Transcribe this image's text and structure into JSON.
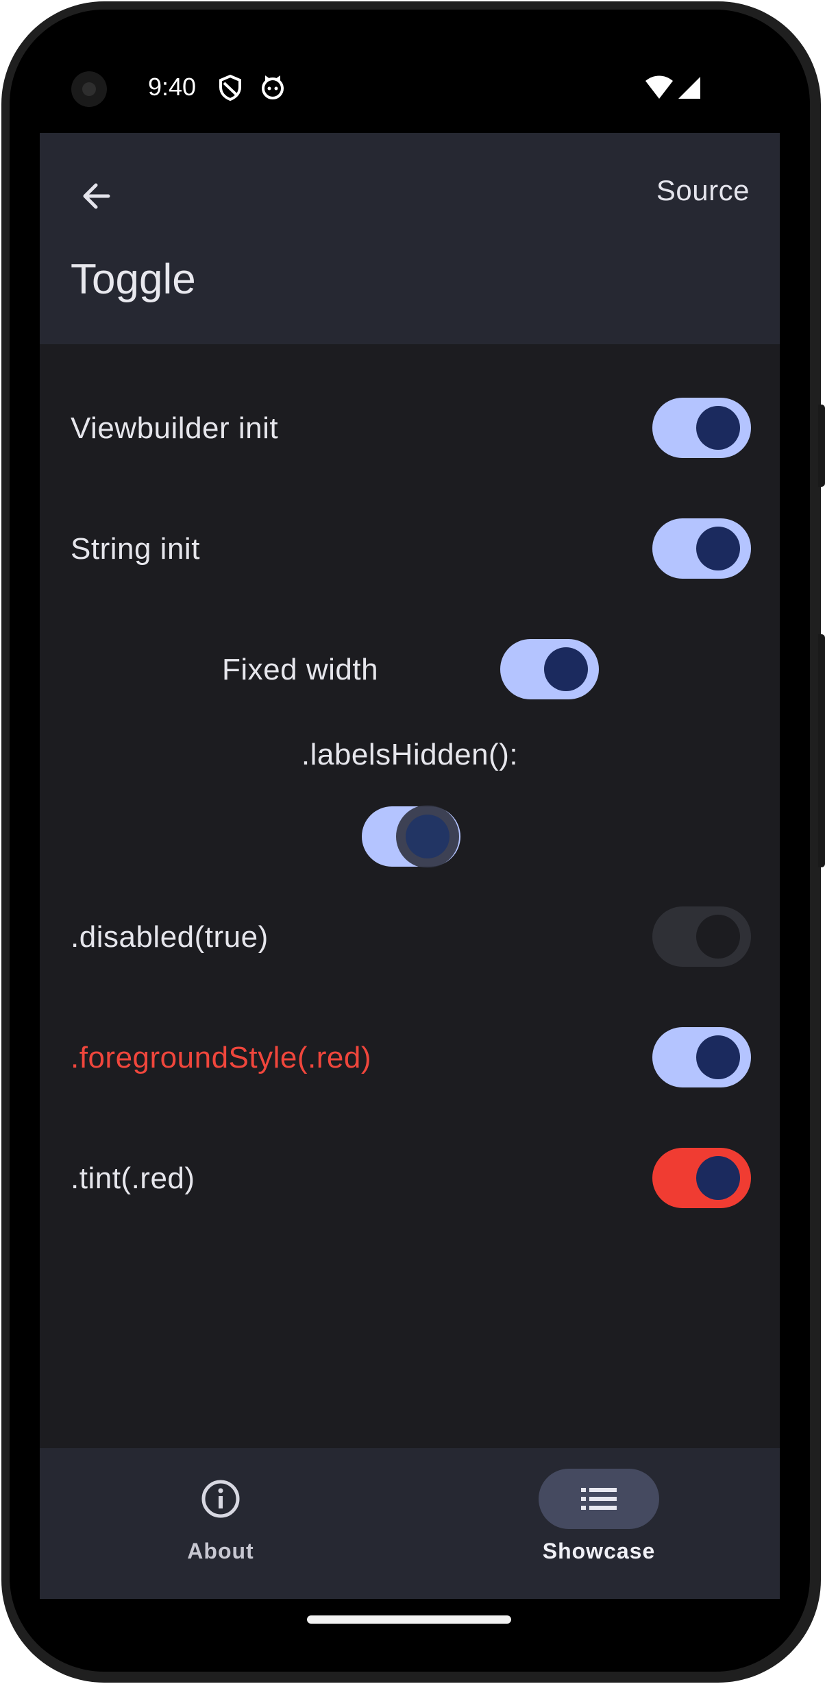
{
  "status_bar": {
    "time": "9:40"
  },
  "app_bar": {
    "title": "Toggle",
    "source_label": "Source"
  },
  "rows": [
    {
      "label": "Viewbuilder init",
      "on": true
    },
    {
      "label": "String init",
      "on": true
    },
    {
      "label": "Fixed width",
      "on": true
    },
    {
      "label": ".labelsHidden():",
      "on": true
    },
    {
      "label": ".disabled(true)",
      "on": true,
      "disabled": true
    },
    {
      "label": ".foregroundStyle(.red)",
      "on": true,
      "label_color": "#f0463c"
    },
    {
      "label": ".tint(.red)",
      "on": true,
      "tint": "#f03c32"
    }
  ],
  "bottom_nav": {
    "items": [
      {
        "label": "About",
        "icon": "info-icon",
        "selected": false
      },
      {
        "label": "Showcase",
        "icon": "list-icon",
        "selected": true
      }
    ]
  },
  "colors": {
    "accent": "#b4c4ff",
    "thumb": "#1b2a5e",
    "surface": "#1c1c20",
    "app_bar": "#262832",
    "red": "#f03c32"
  }
}
